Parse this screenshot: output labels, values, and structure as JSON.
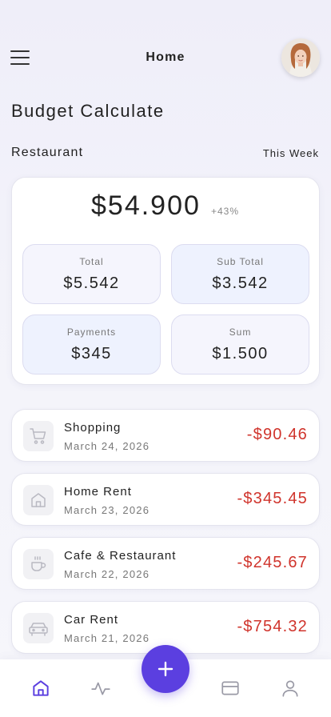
{
  "header": {
    "title": "Home",
    "menu_icon": "hamburger-menu-icon",
    "avatar_icon": "user-avatar"
  },
  "budget": {
    "title": "Budget Calculate",
    "category": "Restaurant",
    "period": "This Week",
    "amount": "$54.900",
    "change": "+43%",
    "stats": [
      {
        "label": "Total",
        "value": "$5.542"
      },
      {
        "label": "Sub Total",
        "value": "$3.542"
      },
      {
        "label": "Payments",
        "value": "$345"
      },
      {
        "label": "Sum",
        "value": "$1.500"
      }
    ]
  },
  "transactions": [
    {
      "title": "Shopping",
      "date": "March 24, 2026",
      "amount": "-$90.46",
      "icon": "shopping-cart-icon"
    },
    {
      "title": "Home Rent",
      "date": "March 23, 2026",
      "amount": "-$345.45",
      "icon": "home-icon"
    },
    {
      "title": "Cafe & Restaurant",
      "date": "March 22, 2026",
      "amount": "-$245.67",
      "icon": "coffee-cup-icon"
    },
    {
      "title": "Car Rent",
      "date": "March 21, 2026",
      "amount": "-$754.32",
      "icon": "car-icon"
    }
  ],
  "colors": {
    "accent": "#5b3fe0",
    "negative": "#d0342c",
    "background": "#f3f3fa"
  },
  "nav": {
    "tabs": [
      "home-icon",
      "activity-icon",
      "add-icon",
      "card-icon",
      "profile-icon"
    ],
    "active": "home-icon"
  }
}
